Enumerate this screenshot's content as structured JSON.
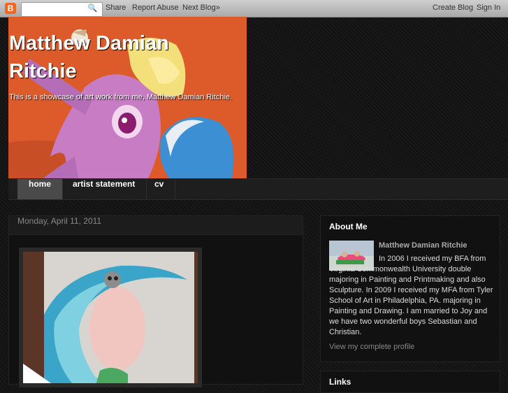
{
  "navbar": {
    "logo": "B",
    "search_placeholder": "",
    "search_icon": "magnifier-icon",
    "links": [
      "Share",
      "Report Abuse",
      "Next Blog»"
    ],
    "right_links": [
      "Create Blog",
      "Sign In"
    ]
  },
  "header": {
    "title": "Matthew Damian Ritchie",
    "description": "This is a showcase of art work from me, Matthew Damian Ritchie."
  },
  "tabs": [
    "home",
    "artist statement",
    "cv"
  ],
  "post": {
    "date": "Monday, April 11, 2011"
  },
  "sidebar": {
    "about_title": "About Me",
    "profile_name": "Matthew Damian Ritchie",
    "bio_first": "In 2006 I received my BFA from",
    "bio_rest": "Virginia Commonwealth University double majoring in Painting and Printmaking and also Sculpture. In 2009 I received my MFA from Tyler School of Art in Philadelphia, PA. majoring in Painting and Drawing. I am married to Joy and we have two wonderful boys Sebastian and Christian.",
    "profile_link": "View my complete profile",
    "links_title": "Links"
  }
}
